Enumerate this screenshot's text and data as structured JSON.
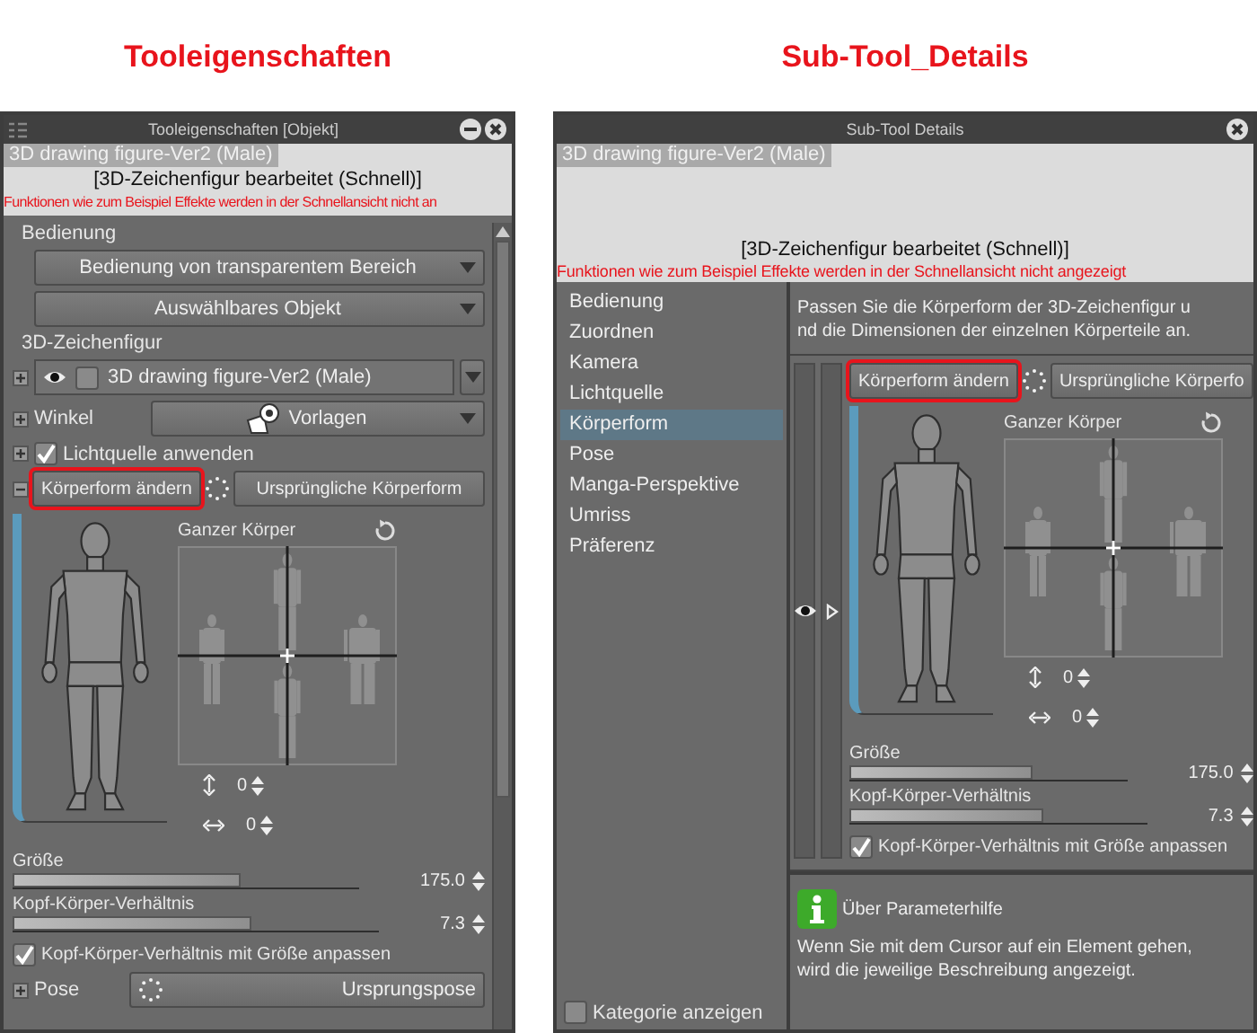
{
  "tool_property": {
    "caption": "Tooleigenschaften",
    "title": "Tooleigenschaften [Objekt]",
    "preview": {
      "name": "3D drawing figure-Ver2 (Male)",
      "status": "[3D-Zeichenfigur bearbeitet (Schnell)]",
      "warning": "Funktionen wie zum Beispiel Effekte werden in der Schnellansicht nicht an"
    },
    "operation": {
      "label": "Bedienung",
      "dropdowns": [
        "Bedienung von transparentem Bereich",
        "Auswählbares Objekt"
      ]
    },
    "figure": {
      "label": "3D-Zeichenfigur",
      "expanded": false,
      "visible": true,
      "checked": false,
      "name": "3D drawing figure-Ver2 (Male)"
    },
    "angle": {
      "label": "Winkel",
      "expanded": false,
      "button": "Vorlagen"
    },
    "light": {
      "label": "Lichtquelle anwenden",
      "expanded": false,
      "checked": true
    },
    "body_shape": {
      "expanded": true,
      "change_button": "Körperform ändern",
      "highlighted": true,
      "reset_button": "Ursprüngliche Körperform",
      "preset_label": "Ganzer Körper",
      "vertical": "0",
      "horizontal": "0",
      "sliders": [
        {
          "label": "Größe",
          "level": 0.66,
          "reading": "175.0"
        },
        {
          "label": "Kopf-Körper-Verhältnis",
          "level": 0.65,
          "reading": "7.3"
        }
      ],
      "link": {
        "label": "Kopf-Körper-Verhältnis mit Größe anpassen",
        "checked": true
      }
    },
    "pose": {
      "label": "Pose",
      "expanded": false,
      "button": "Ursprungspose"
    }
  },
  "sub_tool_details": {
    "caption": "Sub-Tool_Details",
    "title": "Sub-Tool Details",
    "preview": {
      "name": "3D drawing figure-Ver2 (Male)",
      "status": "[3D-Zeichenfigur bearbeitet (Schnell)]",
      "warning": "Funktionen wie zum Beispiel Effekte werden in der Schnellansicht nicht angezeigt"
    },
    "categories": [
      {
        "label": "Bedienung",
        "selected": false
      },
      {
        "label": "Zuordnen",
        "selected": false
      },
      {
        "label": "Kamera",
        "selected": false
      },
      {
        "label": "Lichtquelle",
        "selected": false
      },
      {
        "label": "Körperform",
        "selected": true
      },
      {
        "label": "Pose",
        "selected": false
      },
      {
        "label": "Manga-Perspektive",
        "selected": false
      },
      {
        "label": "Umriss",
        "selected": false
      },
      {
        "label": "Präferenz",
        "selected": false
      }
    ],
    "show_category": {
      "label": "Kategorie anzeigen",
      "checked": false
    },
    "description": [
      "Passen Sie die Körperform der 3D-Zeichenfigur u",
      "nd die Dimensionen der einzelnen Körperteile an."
    ],
    "body_shape": {
      "change_button": "Körperform ändern",
      "highlighted": true,
      "reset_button": "Ursprüngliche Körperfo",
      "preset_label": "Ganzer Körper",
      "vertical": "0",
      "horizontal": "0",
      "sliders": [
        {
          "label": "Größe",
          "level": 0.66,
          "reading": "175.0"
        },
        {
          "label": "Kopf-Körper-Verhältnis",
          "level": 0.65,
          "reading": "7.3"
        }
      ],
      "link": {
        "label": "Kopf-Körper-Verhältnis mit Größe anpassen",
        "checked": true
      }
    },
    "help": {
      "title": "Über Parameterhilfe",
      "text": "Wenn Sie mit dem Cursor auf ein Element gehen, wird die jeweilige Beschreibung angezeigt."
    }
  }
}
